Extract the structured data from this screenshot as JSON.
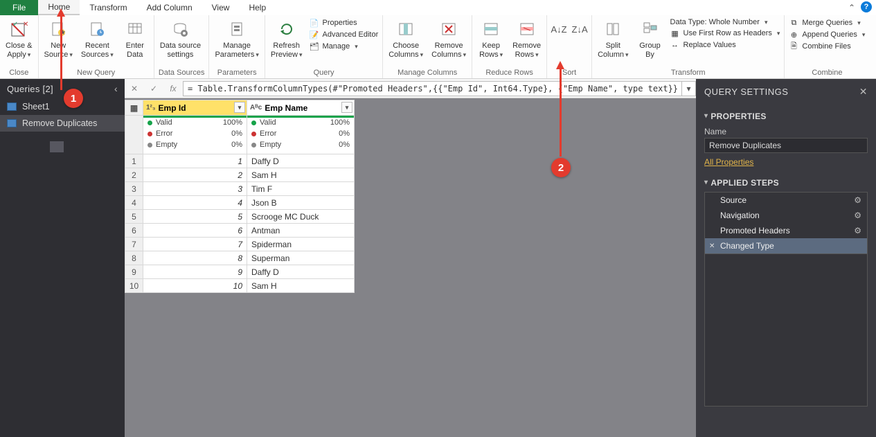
{
  "menu": {
    "file": "File",
    "home": "Home",
    "transform": "Transform",
    "addColumn": "Add Column",
    "view": "View",
    "help": "Help"
  },
  "ribbon": {
    "close": {
      "closeApply": "Close &\nApply",
      "group": "Close"
    },
    "newQuery": {
      "newSource": "New\nSource",
      "recentSources": "Recent\nSources",
      "enterData": "Enter\nData",
      "group": "New Query"
    },
    "dataSources": {
      "settings": "Data source\nsettings",
      "group": "Data Sources"
    },
    "parameters": {
      "manage": "Manage\nParameters",
      "group": "Parameters"
    },
    "query": {
      "refresh": "Refresh\nPreview",
      "properties": "Properties",
      "advEditor": "Advanced Editor",
      "manage": "Manage",
      "group": "Query"
    },
    "manageCols": {
      "choose": "Choose\nColumns",
      "remove": "Remove\nColumns",
      "group": "Manage Columns"
    },
    "reduceRows": {
      "keep": "Keep\nRows",
      "remove": "Remove\nRows",
      "group": "Reduce Rows"
    },
    "sort": {
      "group": "Sort"
    },
    "transform": {
      "split": "Split\nColumn",
      "groupBy": "Group\nBy",
      "dataType": "Data Type: Whole Number",
      "firstRow": "Use First Row as Headers",
      "replace": "Replace Values",
      "group": "Transform"
    },
    "combine": {
      "merge": "Merge Queries",
      "append": "Append Queries",
      "combineFiles": "Combine Files",
      "group": "Combine"
    }
  },
  "formula": "= Table.TransformColumnTypes(#\"Promoted Headers\",{{\"Emp Id\", Int64.Type}, {\"Emp Name\", type text}})",
  "queriesPanel": {
    "title": "Queries [2]",
    "items": [
      "Sheet1",
      "Remove Duplicates"
    ]
  },
  "columns": [
    {
      "name": "Emp Id",
      "typeLabel": "1²₃",
      "valid": "100%",
      "error": "0%",
      "empty": "0%",
      "selected": true
    },
    {
      "name": "Emp Name",
      "typeLabel": "Aᴮc",
      "valid": "100%",
      "error": "0%",
      "empty": "0%",
      "selected": false
    }
  ],
  "quality": {
    "valid": "Valid",
    "error": "Error",
    "empty": "Empty"
  },
  "rows": [
    {
      "id": "1",
      "name": "Daffy D"
    },
    {
      "id": "2",
      "name": "Sam H"
    },
    {
      "id": "3",
      "name": "Tim F"
    },
    {
      "id": "4",
      "name": "Json B"
    },
    {
      "id": "5",
      "name": "Scrooge MC Duck"
    },
    {
      "id": "6",
      "name": "Antman"
    },
    {
      "id": "7",
      "name": "Spiderman"
    },
    {
      "id": "8",
      "name": "Superman"
    },
    {
      "id": "9",
      "name": "Daffy D"
    },
    {
      "id": "10",
      "name": "Sam H"
    }
  ],
  "settings": {
    "title": "QUERY SETTINGS",
    "propHdr": "PROPERTIES",
    "nameLbl": "Name",
    "nameVal": "Remove Duplicates",
    "allProps": "All Properties",
    "stepsHdr": "APPLIED STEPS",
    "steps": [
      {
        "label": "Source",
        "gear": true
      },
      {
        "label": "Navigation",
        "gear": true
      },
      {
        "label": "Promoted Headers",
        "gear": true
      },
      {
        "label": "Changed Type",
        "gear": false,
        "selected": true
      }
    ]
  },
  "callouts": {
    "one": "1",
    "two": "2"
  }
}
